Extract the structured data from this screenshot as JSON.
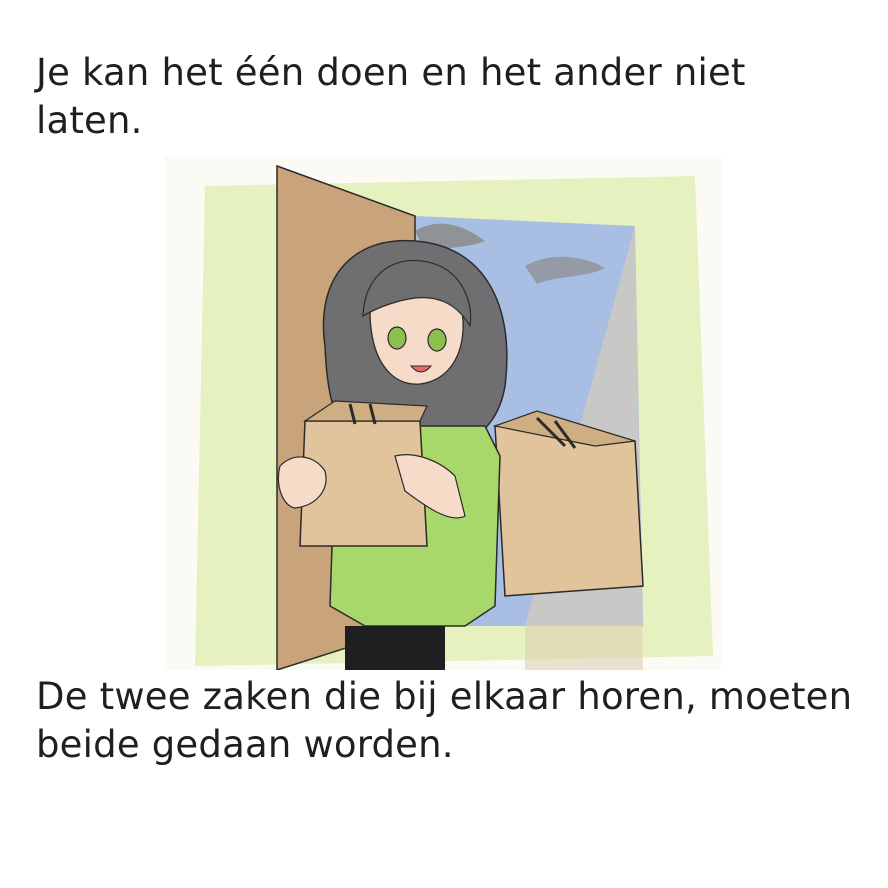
{
  "page": {
    "background": "#ffffff"
  },
  "captions": {
    "top": "Je kan het één doen en het ander niet laten.",
    "bottom": "De twee zaken die bij elkaar horen, moeten beide gedaan worden."
  },
  "illustration": {
    "icon": "girl-carrying-boxes-drawing",
    "colors": {
      "paper": "#fbfaf5",
      "wash": "#e2efb6",
      "door": "#c9a47a",
      "sky": "#a8bfe3",
      "cloud": "#8f9296",
      "hair": "#6f6f72",
      "skin": "#f6dcc8",
      "dress": "#a9d86a",
      "box": "#e2c49c",
      "legs": "#1f1f22"
    }
  }
}
